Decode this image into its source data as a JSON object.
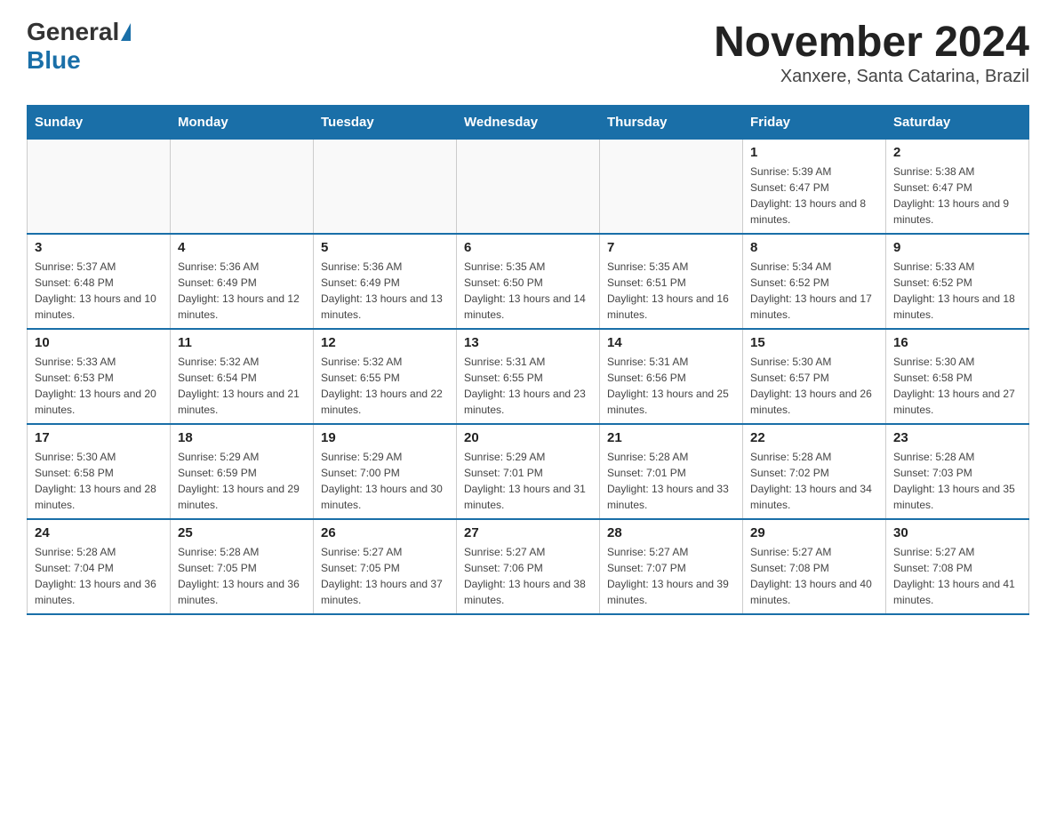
{
  "header": {
    "logo_general": "General",
    "logo_blue": "Blue",
    "month_title": "November 2024",
    "location": "Xanxere, Santa Catarina, Brazil"
  },
  "days_of_week": [
    "Sunday",
    "Monday",
    "Tuesday",
    "Wednesday",
    "Thursday",
    "Friday",
    "Saturday"
  ],
  "weeks": [
    [
      {
        "day": "",
        "info": ""
      },
      {
        "day": "",
        "info": ""
      },
      {
        "day": "",
        "info": ""
      },
      {
        "day": "",
        "info": ""
      },
      {
        "day": "",
        "info": ""
      },
      {
        "day": "1",
        "info": "Sunrise: 5:39 AM\nSunset: 6:47 PM\nDaylight: 13 hours and 8 minutes."
      },
      {
        "day": "2",
        "info": "Sunrise: 5:38 AM\nSunset: 6:47 PM\nDaylight: 13 hours and 9 minutes."
      }
    ],
    [
      {
        "day": "3",
        "info": "Sunrise: 5:37 AM\nSunset: 6:48 PM\nDaylight: 13 hours and 10 minutes."
      },
      {
        "day": "4",
        "info": "Sunrise: 5:36 AM\nSunset: 6:49 PM\nDaylight: 13 hours and 12 minutes."
      },
      {
        "day": "5",
        "info": "Sunrise: 5:36 AM\nSunset: 6:49 PM\nDaylight: 13 hours and 13 minutes."
      },
      {
        "day": "6",
        "info": "Sunrise: 5:35 AM\nSunset: 6:50 PM\nDaylight: 13 hours and 14 minutes."
      },
      {
        "day": "7",
        "info": "Sunrise: 5:35 AM\nSunset: 6:51 PM\nDaylight: 13 hours and 16 minutes."
      },
      {
        "day": "8",
        "info": "Sunrise: 5:34 AM\nSunset: 6:52 PM\nDaylight: 13 hours and 17 minutes."
      },
      {
        "day": "9",
        "info": "Sunrise: 5:33 AM\nSunset: 6:52 PM\nDaylight: 13 hours and 18 minutes."
      }
    ],
    [
      {
        "day": "10",
        "info": "Sunrise: 5:33 AM\nSunset: 6:53 PM\nDaylight: 13 hours and 20 minutes."
      },
      {
        "day": "11",
        "info": "Sunrise: 5:32 AM\nSunset: 6:54 PM\nDaylight: 13 hours and 21 minutes."
      },
      {
        "day": "12",
        "info": "Sunrise: 5:32 AM\nSunset: 6:55 PM\nDaylight: 13 hours and 22 minutes."
      },
      {
        "day": "13",
        "info": "Sunrise: 5:31 AM\nSunset: 6:55 PM\nDaylight: 13 hours and 23 minutes."
      },
      {
        "day": "14",
        "info": "Sunrise: 5:31 AM\nSunset: 6:56 PM\nDaylight: 13 hours and 25 minutes."
      },
      {
        "day": "15",
        "info": "Sunrise: 5:30 AM\nSunset: 6:57 PM\nDaylight: 13 hours and 26 minutes."
      },
      {
        "day": "16",
        "info": "Sunrise: 5:30 AM\nSunset: 6:58 PM\nDaylight: 13 hours and 27 minutes."
      }
    ],
    [
      {
        "day": "17",
        "info": "Sunrise: 5:30 AM\nSunset: 6:58 PM\nDaylight: 13 hours and 28 minutes."
      },
      {
        "day": "18",
        "info": "Sunrise: 5:29 AM\nSunset: 6:59 PM\nDaylight: 13 hours and 29 minutes."
      },
      {
        "day": "19",
        "info": "Sunrise: 5:29 AM\nSunset: 7:00 PM\nDaylight: 13 hours and 30 minutes."
      },
      {
        "day": "20",
        "info": "Sunrise: 5:29 AM\nSunset: 7:01 PM\nDaylight: 13 hours and 31 minutes."
      },
      {
        "day": "21",
        "info": "Sunrise: 5:28 AM\nSunset: 7:01 PM\nDaylight: 13 hours and 33 minutes."
      },
      {
        "day": "22",
        "info": "Sunrise: 5:28 AM\nSunset: 7:02 PM\nDaylight: 13 hours and 34 minutes."
      },
      {
        "day": "23",
        "info": "Sunrise: 5:28 AM\nSunset: 7:03 PM\nDaylight: 13 hours and 35 minutes."
      }
    ],
    [
      {
        "day": "24",
        "info": "Sunrise: 5:28 AM\nSunset: 7:04 PM\nDaylight: 13 hours and 36 minutes."
      },
      {
        "day": "25",
        "info": "Sunrise: 5:28 AM\nSunset: 7:05 PM\nDaylight: 13 hours and 36 minutes."
      },
      {
        "day": "26",
        "info": "Sunrise: 5:27 AM\nSunset: 7:05 PM\nDaylight: 13 hours and 37 minutes."
      },
      {
        "day": "27",
        "info": "Sunrise: 5:27 AM\nSunset: 7:06 PM\nDaylight: 13 hours and 38 minutes."
      },
      {
        "day": "28",
        "info": "Sunrise: 5:27 AM\nSunset: 7:07 PM\nDaylight: 13 hours and 39 minutes."
      },
      {
        "day": "29",
        "info": "Sunrise: 5:27 AM\nSunset: 7:08 PM\nDaylight: 13 hours and 40 minutes."
      },
      {
        "day": "30",
        "info": "Sunrise: 5:27 AM\nSunset: 7:08 PM\nDaylight: 13 hours and 41 minutes."
      }
    ]
  ]
}
